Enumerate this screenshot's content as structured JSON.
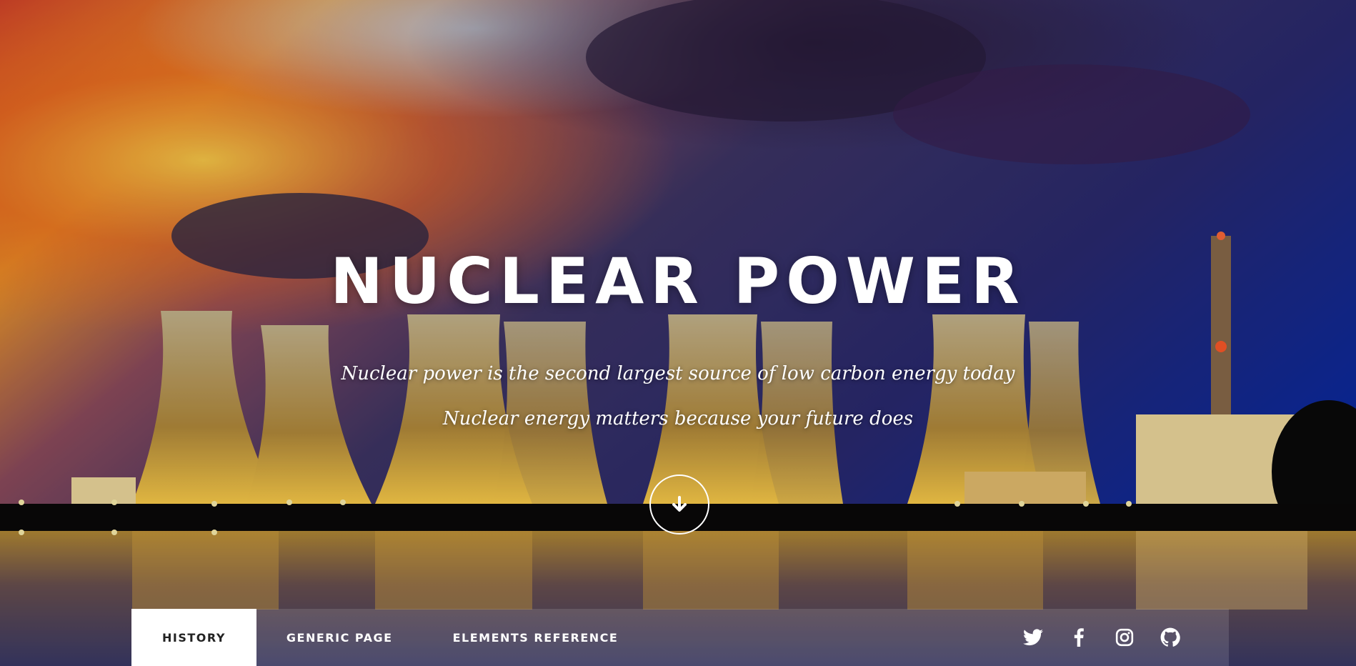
{
  "hero": {
    "title": "NUCLEAR POWER",
    "subtitle_1": "Nuclear power is the second largest source of low carbon energy today",
    "subtitle_2": "Nuclear energy matters because your future does",
    "scroll_icon": "arrow-down-circle-icon"
  },
  "nav": {
    "items": [
      {
        "label": "HISTORY",
        "active": true
      },
      {
        "label": "GENERIC PAGE",
        "active": false
      },
      {
        "label": "ELEMENTS REFERENCE",
        "active": false
      }
    ],
    "social": [
      {
        "icon": "twitter-icon"
      },
      {
        "icon": "facebook-icon"
      },
      {
        "icon": "instagram-icon"
      },
      {
        "icon": "github-icon"
      }
    ]
  },
  "colors": {
    "text": "#ffffff",
    "active_tab_bg": "#ffffff",
    "active_tab_text": "#222222"
  }
}
